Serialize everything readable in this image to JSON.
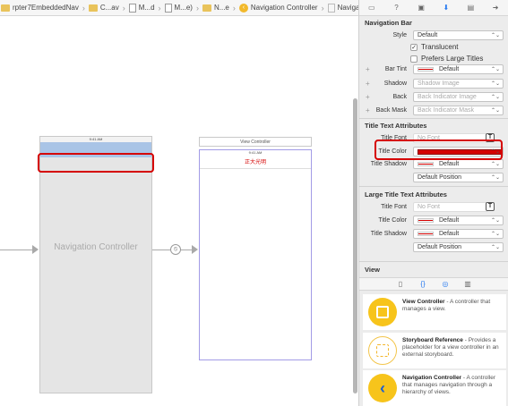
{
  "jumpbar": {
    "items": [
      {
        "label": "rpter7EmbeddedNav",
        "icon": "folder-icon"
      },
      {
        "label": "C...av",
        "icon": "folder-icon"
      },
      {
        "label": "M...d",
        "icon": "file-icon"
      },
      {
        "label": "M...e)",
        "icon": "file-icon"
      },
      {
        "label": "N...e",
        "icon": "folder-icon"
      },
      {
        "label": "Navigation Controller",
        "icon": "navigation-controller-icon"
      },
      {
        "label": "Navigation Bar",
        "icon": "document-icon"
      }
    ]
  },
  "canvas": {
    "nav_controller_label": "Navigation Controller",
    "nav_scene_time": "9:41 AM",
    "view_controller_bar_label": "View Controller",
    "vc_scene_time": "9:41 AM",
    "vc_title": "正大光明"
  },
  "inspector": {
    "tabs": [
      "file-inspector-icon",
      "quick-help-icon",
      "identity-inspector-icon",
      "attributes-inspector-icon",
      "size-inspector-icon",
      "connections-inspector-icon"
    ],
    "navigation_bar": {
      "section_title": "Navigation Bar",
      "style_label": "Style",
      "style_value": "Default",
      "translucent_label": "Translucent",
      "translucent_checked": true,
      "prefers_large_titles_label": "Prefers Large Titles",
      "prefers_large_titles_checked": false,
      "bar_tint_label": "Bar Tint",
      "bar_tint_value": "Default",
      "shadow_label": "Shadow",
      "shadow_placeholder": "Shadow Image",
      "back_label": "Back",
      "back_placeholder": "Back Indicator Image",
      "back_mask_label": "Back Mask",
      "back_mask_placeholder": "Back Indicator Mask"
    },
    "title_text_attributes": {
      "section_title": "Title Text Attributes",
      "title_font_label": "Title Font",
      "title_font_placeholder": "No Font",
      "title_color_label": "Title Color",
      "title_color": "#d50000",
      "title_shadow_label": "Title Shadow",
      "title_shadow_value": "Default",
      "position_value": "Default Position"
    },
    "large_title_text_attributes": {
      "section_title": "Large Title Text Attributes",
      "title_font_label": "Title Font",
      "title_font_placeholder": "No Font",
      "title_color_label": "Title Color",
      "title_color_value": "Default",
      "title_shadow_label": "Title Shadow",
      "title_shadow_value": "Default",
      "position_value": "Default Position"
    },
    "view_section_title": "View"
  },
  "library": {
    "tabs": [
      "file-template-icon",
      "code-snippet-icon",
      "object-library-icon",
      "media-library-icon"
    ],
    "items": [
      {
        "title": "View Controller",
        "description": " - A controller that manages a view."
      },
      {
        "title": "Storyboard Reference",
        "description": " - Provides a placeholder for a view controller in an external storyboard."
      },
      {
        "title": "Navigation Controller",
        "description": " - A controller that manages navigation through a hierarchy of views."
      }
    ]
  }
}
